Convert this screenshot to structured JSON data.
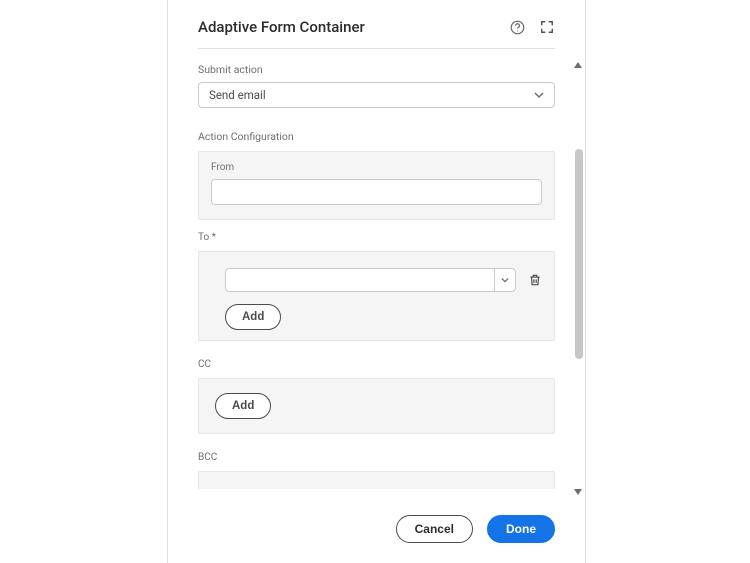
{
  "dialog": {
    "title": "Adaptive Form Container"
  },
  "submit": {
    "label": "Submit action",
    "selected": "Send email"
  },
  "action_config": {
    "label": "Action Configuration",
    "from_label": "From",
    "from_value": "",
    "to_label": "To *",
    "to_value": "",
    "cc_label": "CC",
    "bcc_label": "BCC",
    "add_button": "Add"
  },
  "footer": {
    "cancel": "Cancel",
    "done": "Done"
  },
  "icons": {
    "help": "help-icon",
    "fullscreen": "fullscreen-icon",
    "collapse_up": "caret-up-icon",
    "collapse_down": "caret-down-icon",
    "chevron_down": "chevron-down-icon",
    "delete": "trash-icon"
  }
}
